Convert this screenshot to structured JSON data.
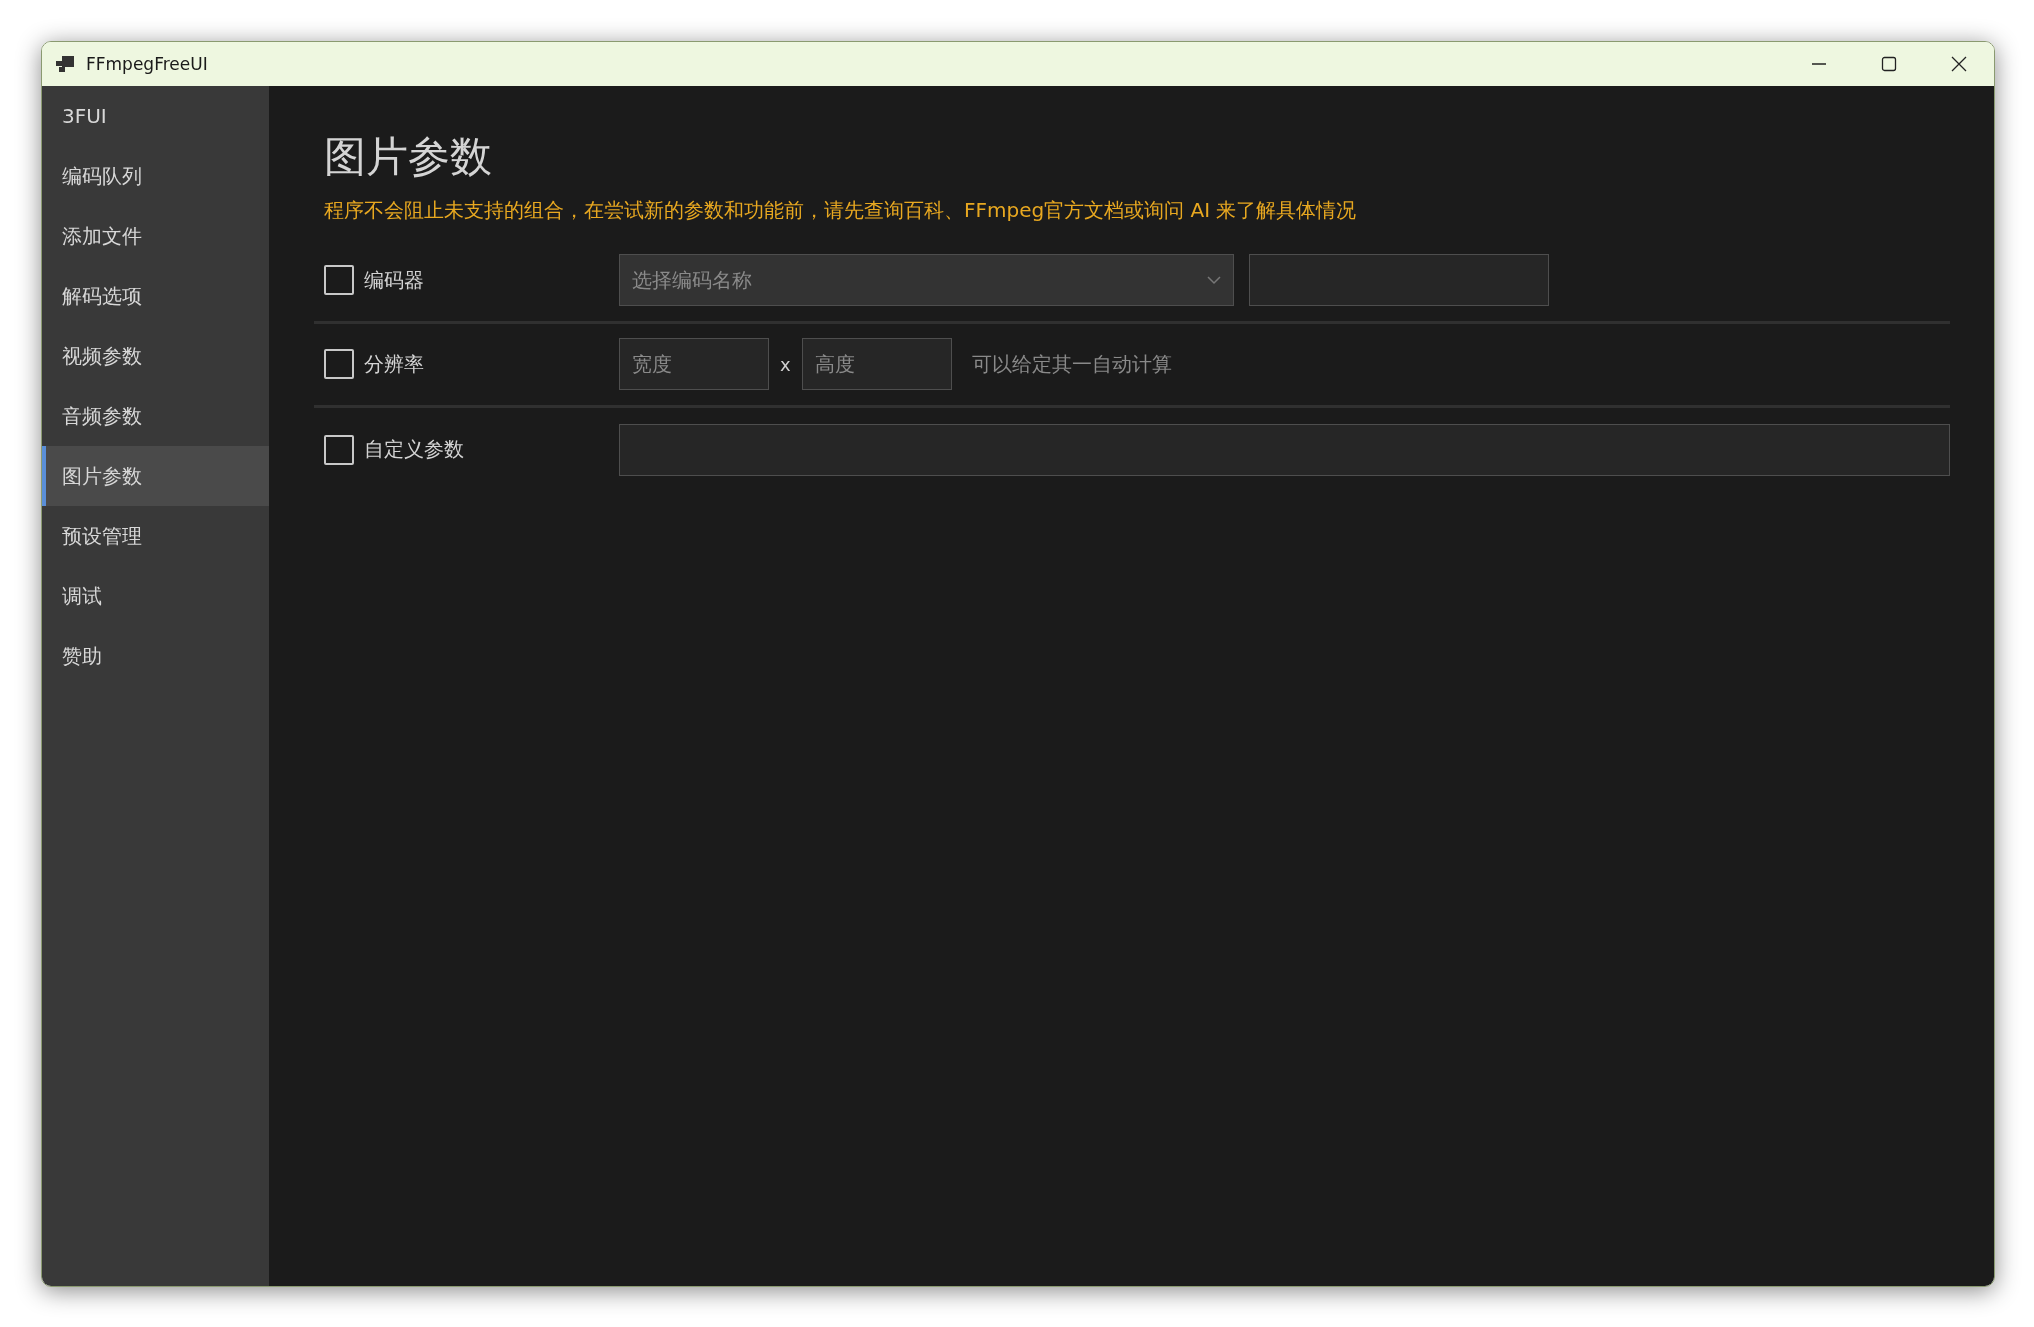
{
  "window": {
    "title": "FFmpegFreeUI"
  },
  "sidebar": {
    "items": [
      {
        "label": "3FUI",
        "selected": false
      },
      {
        "label": "编码队列",
        "selected": false
      },
      {
        "label": "添加文件",
        "selected": false
      },
      {
        "label": "解码选项",
        "selected": false
      },
      {
        "label": "视频参数",
        "selected": false
      },
      {
        "label": "音频参数",
        "selected": false
      },
      {
        "label": "图片参数",
        "selected": true
      },
      {
        "label": "预设管理",
        "selected": false
      },
      {
        "label": "调试",
        "selected": false
      },
      {
        "label": "赞助",
        "selected": false
      }
    ]
  },
  "page": {
    "title": "图片参数",
    "warning": "程序不会阻止未支持的组合，在尝试新的参数和功能前，请先查询百科、FFmpeg官方文档或询问 AI 来了解具体情况"
  },
  "rows": [
    {
      "kind": "encoder",
      "label": "编码器",
      "checked": false,
      "select_placeholder": "选择编码名称"
    },
    {
      "kind": "resolution",
      "label": "分辨率",
      "checked": false,
      "width_placeholder": "宽度",
      "separator": "x",
      "height_placeholder": "高度",
      "hint": "可以给定其一自动计算"
    },
    {
      "kind": "custom",
      "label": "自定义参数",
      "checked": false
    }
  ]
}
